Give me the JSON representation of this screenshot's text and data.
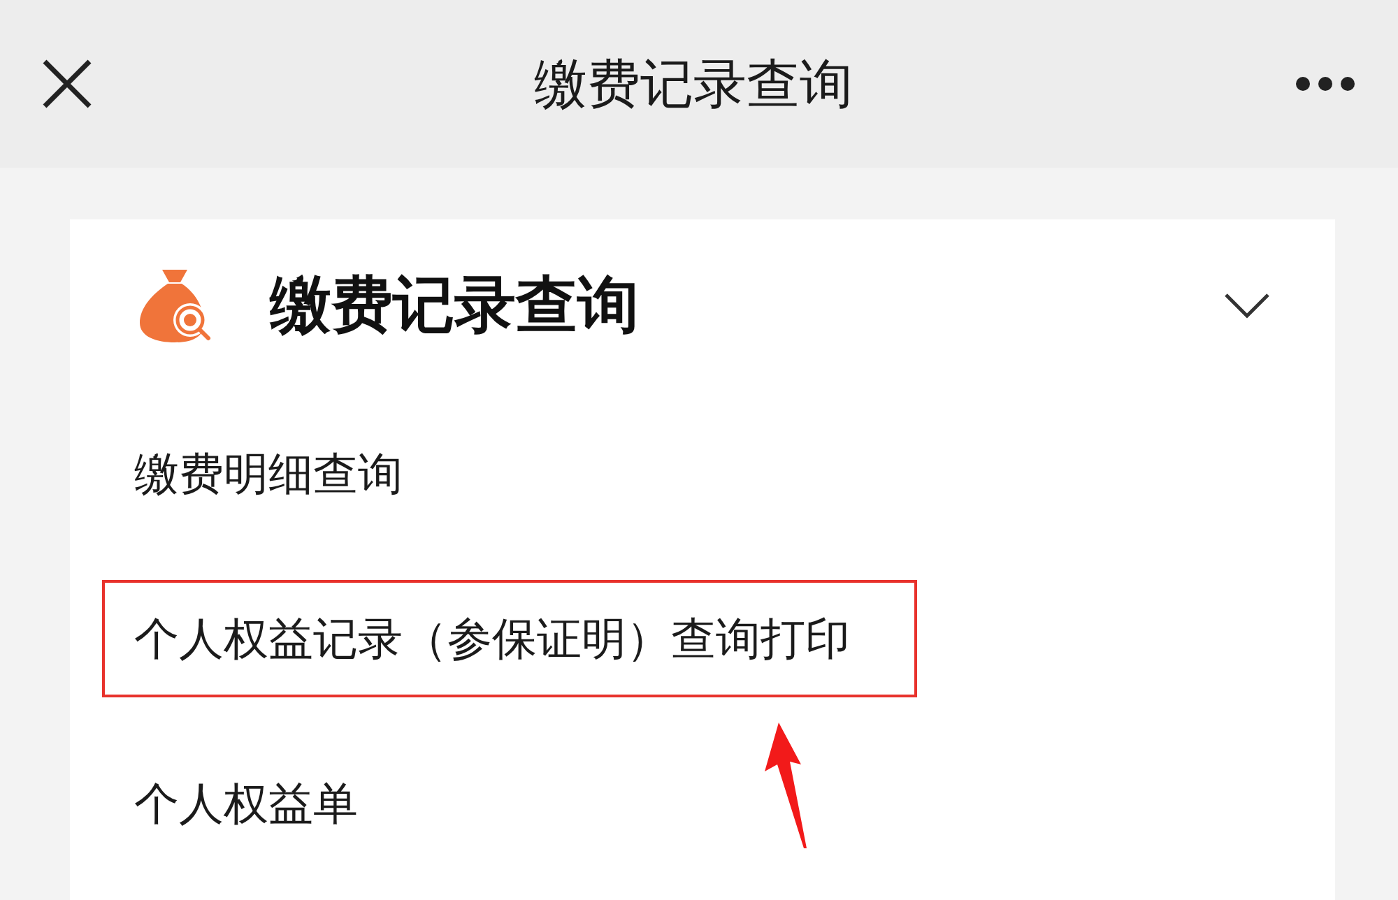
{
  "window": {
    "title": "缴费记录查询"
  },
  "section": {
    "title": "缴费记录查询",
    "expanded": true,
    "items": [
      {
        "label": "缴费明细查询",
        "highlighted": false
      },
      {
        "label": "个人权益记录（参保证明）查询打印",
        "highlighted": true
      },
      {
        "label": "个人权益单",
        "highlighted": false
      }
    ]
  }
}
